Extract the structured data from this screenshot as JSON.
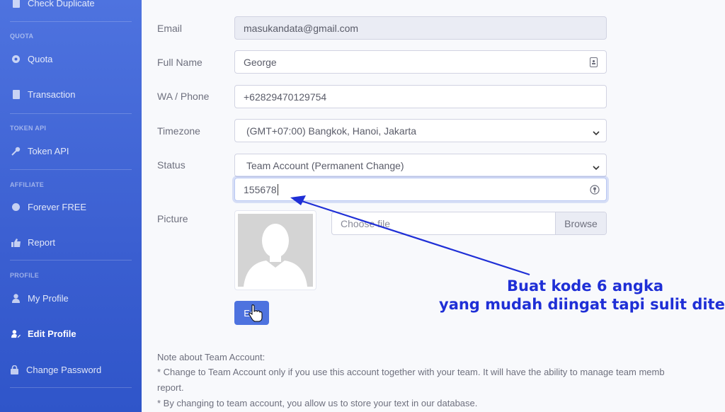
{
  "sidebar": {
    "check_duplicate": "Check Duplicate",
    "sections": {
      "quota": "QUOTA",
      "token_api": "TOKEN API",
      "affiliate": "AFFILIATE",
      "profile": "PROFILE"
    },
    "items": {
      "quota": "Quota",
      "transaction": "Transaction",
      "token_api": "Token API",
      "forever_free": "Forever FREE",
      "report": "Report",
      "my_profile": "My Profile",
      "edit_profile": "Edit Profile",
      "change_password": "Change Password"
    }
  },
  "form": {
    "email": {
      "label": "Email",
      "value": "masukandata@gmail.com"
    },
    "full_name": {
      "label": "Full Name",
      "value": "George"
    },
    "phone": {
      "label": "WA / Phone",
      "value": "+62829470129754"
    },
    "timezone": {
      "label": "Timezone",
      "value": "(GMT+07:00) Bangkok, Hanoi, Jakarta"
    },
    "status": {
      "label": "Status",
      "value": "Team Account (Permanent Change)"
    },
    "pin": {
      "value": "155678"
    },
    "picture": {
      "label": "Picture",
      "file_placeholder": "Choose file",
      "browse": "Browse"
    },
    "edit_button": "Edit"
  },
  "note": {
    "title": "Note about Team Account:",
    "line1": "* Change to Team Account only if you use this account together with your team. It will have the ability to manage team memb",
    "line2": "report.",
    "line3": "* By changing to team account, you allow us to store your text in our database."
  },
  "annotation": {
    "line1": "Buat kode 6 angka",
    "line2": "yang mudah diingat tapi sulit ditebak",
    "color": "#1f2fd6"
  },
  "colors": {
    "sidebar": "#4e73df",
    "primary": "#4e73df"
  }
}
